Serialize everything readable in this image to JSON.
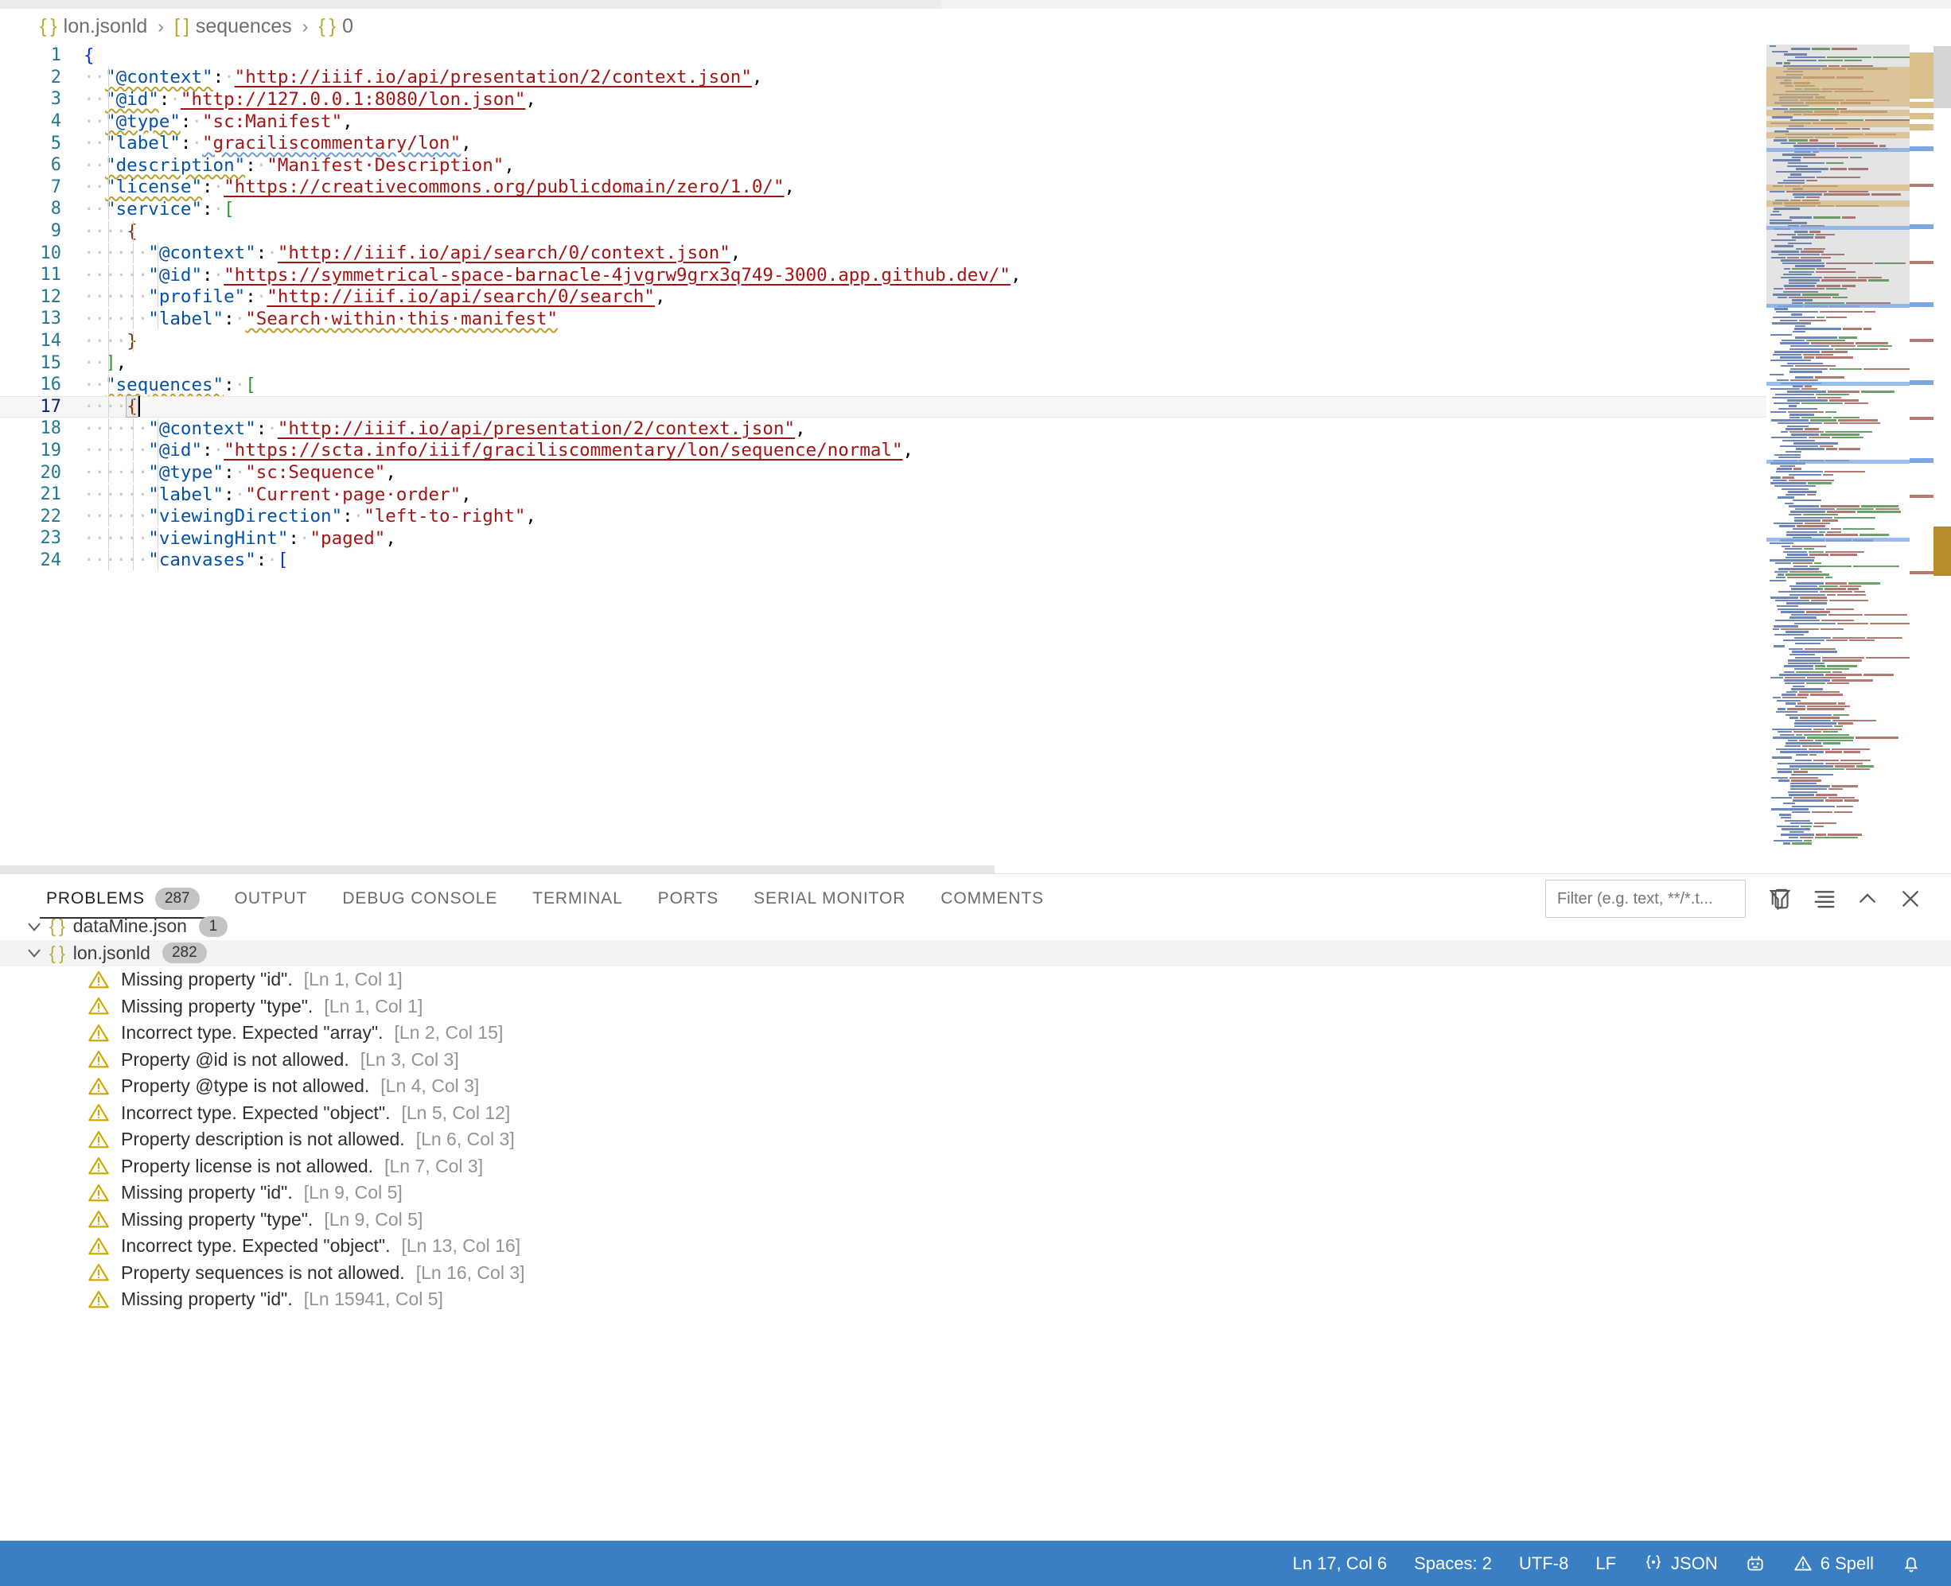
{
  "breadcrumb": {
    "items": [
      {
        "icon": "json-object-icon",
        "sym": "{ }",
        "label": "lon.jsonld"
      },
      {
        "icon": "json-array-icon",
        "sym": "[ ]",
        "label": "sequences"
      },
      {
        "icon": "json-object-icon",
        "sym": "{ }",
        "label": "0"
      }
    ],
    "separator": "›"
  },
  "editor": {
    "language": "JSON",
    "cursor_line": 17,
    "lines": [
      {
        "n": 1,
        "tokens": [
          {
            "t": "{",
            "c": "br"
          }
        ]
      },
      {
        "n": 2,
        "tokens": [
          {
            "t": "··",
            "c": "dot"
          },
          {
            "t": "\"@context\"",
            "c": "k sq"
          },
          {
            "t": ":",
            "c": "p"
          },
          {
            "t": "·",
            "c": "dot"
          },
          {
            "t": "\"http://iiif.io/api/presentation/2/context.json\"",
            "c": "s ul"
          },
          {
            "t": ",",
            "c": "p"
          }
        ]
      },
      {
        "n": 3,
        "tokens": [
          {
            "t": "··",
            "c": "dot"
          },
          {
            "t": "\"@id\"",
            "c": "k sq"
          },
          {
            "t": ":",
            "c": "p"
          },
          {
            "t": "·",
            "c": "dot"
          },
          {
            "t": "\"http://127.0.0.1:8080/lon.json\"",
            "c": "s ul"
          },
          {
            "t": ",",
            "c": "p"
          }
        ]
      },
      {
        "n": 4,
        "tokens": [
          {
            "t": "··",
            "c": "dot"
          },
          {
            "t": "\"@type\"",
            "c": "k sq"
          },
          {
            "t": ":",
            "c": "p"
          },
          {
            "t": "·",
            "c": "dot"
          },
          {
            "t": "\"sc:Manifest\"",
            "c": "s"
          },
          {
            "t": ",",
            "c": "p"
          }
        ]
      },
      {
        "n": 5,
        "tokens": [
          {
            "t": "··",
            "c": "dot"
          },
          {
            "t": "\"label\"",
            "c": "k"
          },
          {
            "t": ":",
            "c": "p"
          },
          {
            "t": "·",
            "c": "dot"
          },
          {
            "t": "\"graciliscommentary/lon\"",
            "c": "s sqb"
          },
          {
            "t": ",",
            "c": "p"
          }
        ]
      },
      {
        "n": 6,
        "tokens": [
          {
            "t": "··",
            "c": "dot"
          },
          {
            "t": "\"description\"",
            "c": "k sq"
          },
          {
            "t": ":",
            "c": "p"
          },
          {
            "t": "·",
            "c": "dot"
          },
          {
            "t": "\"Manifest·Description\"",
            "c": "s"
          },
          {
            "t": ",",
            "c": "p"
          }
        ]
      },
      {
        "n": 7,
        "tokens": [
          {
            "t": "··",
            "c": "dot"
          },
          {
            "t": "\"license\"",
            "c": "k sq"
          },
          {
            "t": ":",
            "c": "p"
          },
          {
            "t": "·",
            "c": "dot"
          },
          {
            "t": "\"https://creativecommons.org/publicdomain/zero/1.0/\"",
            "c": "s ul"
          },
          {
            "t": ",",
            "c": "p"
          }
        ]
      },
      {
        "n": 8,
        "tokens": [
          {
            "t": "··",
            "c": "dot"
          },
          {
            "t": "\"service\"",
            "c": "k"
          },
          {
            "t": ":",
            "c": "p"
          },
          {
            "t": "·",
            "c": "dot"
          },
          {
            "t": "[",
            "c": "br2"
          }
        ]
      },
      {
        "n": 9,
        "tokens": [
          {
            "t": "····",
            "c": "dot"
          },
          {
            "t": "{",
            "c": "br3"
          }
        ]
      },
      {
        "n": 10,
        "tokens": [
          {
            "t": "······",
            "c": "dot"
          },
          {
            "t": "\"@context\"",
            "c": "k"
          },
          {
            "t": ":",
            "c": "p"
          },
          {
            "t": "·",
            "c": "dot"
          },
          {
            "t": "\"http://iiif.io/api/search/0/context.json\"",
            "c": "s ul"
          },
          {
            "t": ",",
            "c": "p"
          }
        ]
      },
      {
        "n": 11,
        "tokens": [
          {
            "t": "······",
            "c": "dot"
          },
          {
            "t": "\"@id\"",
            "c": "k"
          },
          {
            "t": ":",
            "c": "p"
          },
          {
            "t": "·",
            "c": "dot"
          },
          {
            "t": "\"https://symmetrical-space-barnacle-4jvgrw9grx3q749-3000.app.github.dev/\"",
            "c": "s ul"
          },
          {
            "t": ",",
            "c": "p"
          }
        ]
      },
      {
        "n": 12,
        "tokens": [
          {
            "t": "······",
            "c": "dot"
          },
          {
            "t": "\"profile\"",
            "c": "k"
          },
          {
            "t": ":",
            "c": "p"
          },
          {
            "t": "·",
            "c": "dot"
          },
          {
            "t": "\"http://iiif.io/api/search/0/search\"",
            "c": "s ul"
          },
          {
            "t": ",",
            "c": "p"
          }
        ]
      },
      {
        "n": 13,
        "tokens": [
          {
            "t": "······",
            "c": "dot"
          },
          {
            "t": "\"label\"",
            "c": "k"
          },
          {
            "t": ":",
            "c": "p"
          },
          {
            "t": "·",
            "c": "dot"
          },
          {
            "t": "\"Search·within·this·manifest\"",
            "c": "s sq"
          }
        ]
      },
      {
        "n": 14,
        "tokens": [
          {
            "t": "····",
            "c": "dot"
          },
          {
            "t": "}",
            "c": "br3"
          }
        ]
      },
      {
        "n": 15,
        "tokens": [
          {
            "t": "··",
            "c": "dot"
          },
          {
            "t": "]",
            "c": "br2"
          },
          {
            "t": ",",
            "c": "p"
          }
        ]
      },
      {
        "n": 16,
        "tokens": [
          {
            "t": "··",
            "c": "dot"
          },
          {
            "t": "\"sequences\"",
            "c": "k sq"
          },
          {
            "t": ":",
            "c": "p"
          },
          {
            "t": "·",
            "c": "dot"
          },
          {
            "t": "[",
            "c": "br2"
          }
        ]
      },
      {
        "n": 17,
        "tokens": [
          {
            "t": "····",
            "c": "dot"
          },
          {
            "t": "{",
            "c": "br3 bracketbox"
          }
        ],
        "current": true,
        "cursor": true
      },
      {
        "n": 18,
        "tokens": [
          {
            "t": "······",
            "c": "dot"
          },
          {
            "t": "\"@context\"",
            "c": "k"
          },
          {
            "t": ":",
            "c": "p"
          },
          {
            "t": "·",
            "c": "dot"
          },
          {
            "t": "\"http://iiif.io/api/presentation/2/context.json\"",
            "c": "s ul"
          },
          {
            "t": ",",
            "c": "p"
          }
        ]
      },
      {
        "n": 19,
        "tokens": [
          {
            "t": "······",
            "c": "dot"
          },
          {
            "t": "\"@id\"",
            "c": "k"
          },
          {
            "t": ":",
            "c": "p"
          },
          {
            "t": "·",
            "c": "dot"
          },
          {
            "t": "\"https://scta.info/iiif/graciliscommentary/lon/sequence/normal\"",
            "c": "s ul"
          },
          {
            "t": ",",
            "c": "p"
          }
        ]
      },
      {
        "n": 20,
        "tokens": [
          {
            "t": "······",
            "c": "dot"
          },
          {
            "t": "\"@type\"",
            "c": "k"
          },
          {
            "t": ":",
            "c": "p"
          },
          {
            "t": "·",
            "c": "dot"
          },
          {
            "t": "\"sc:Sequence\"",
            "c": "s"
          },
          {
            "t": ",",
            "c": "p"
          }
        ]
      },
      {
        "n": 21,
        "tokens": [
          {
            "t": "······",
            "c": "dot"
          },
          {
            "t": "\"label\"",
            "c": "k"
          },
          {
            "t": ":",
            "c": "p"
          },
          {
            "t": "·",
            "c": "dot"
          },
          {
            "t": "\"Current·page·order\"",
            "c": "s"
          },
          {
            "t": ",",
            "c": "p"
          }
        ]
      },
      {
        "n": 22,
        "tokens": [
          {
            "t": "······",
            "c": "dot"
          },
          {
            "t": "\"viewingDirection\"",
            "c": "k"
          },
          {
            "t": ":",
            "c": "p"
          },
          {
            "t": "·",
            "c": "dot"
          },
          {
            "t": "\"left-to-right\"",
            "c": "s"
          },
          {
            "t": ",",
            "c": "p"
          }
        ]
      },
      {
        "n": 23,
        "tokens": [
          {
            "t": "······",
            "c": "dot"
          },
          {
            "t": "\"viewingHint\"",
            "c": "k"
          },
          {
            "t": ":",
            "c": "p"
          },
          {
            "t": "·",
            "c": "dot"
          },
          {
            "t": "\"paged\"",
            "c": "s"
          },
          {
            "t": ",",
            "c": "p"
          }
        ]
      },
      {
        "n": 24,
        "tokens": [
          {
            "t": "······",
            "c": "dot"
          },
          {
            "t": "\"canvases\"",
            "c": "k"
          },
          {
            "t": ":",
            "c": "p"
          },
          {
            "t": "·",
            "c": "dot"
          },
          {
            "t": "[",
            "c": "br"
          }
        ]
      }
    ]
  },
  "panel": {
    "tabs": [
      {
        "label": "PROBLEMS",
        "badge": "287",
        "active": true
      },
      {
        "label": "OUTPUT",
        "badge": null,
        "active": false
      },
      {
        "label": "DEBUG CONSOLE",
        "badge": null,
        "active": false
      },
      {
        "label": "TERMINAL",
        "badge": null,
        "active": false
      },
      {
        "label": "PORTS",
        "badge": null,
        "active": false
      },
      {
        "label": "SERIAL MONITOR",
        "badge": null,
        "active": false
      },
      {
        "label": "COMMENTS",
        "badge": null,
        "active": false
      }
    ],
    "filter": {
      "value": "",
      "placeholder": "Filter (e.g. text, **/*.t..."
    },
    "actions": [
      {
        "name": "filter-icon",
        "title": "Filter"
      },
      {
        "name": "split-panel-icon",
        "title": "Views and More Actions"
      },
      {
        "name": "collapse-all-icon",
        "title": "Collapse All"
      },
      {
        "name": "chevron-up-icon",
        "title": "Maximize Panel Size"
      },
      {
        "name": "close-icon",
        "title": "Close Panel"
      }
    ],
    "groups": [
      {
        "sym": "{ }",
        "file": "dataMine.json",
        "count": "1",
        "expanded": true,
        "problems": []
      },
      {
        "sym": "{ }",
        "file": "lon.jsonld",
        "count": "282",
        "expanded": true,
        "problems": [
          {
            "severity": "warning",
            "message": "Missing property \"id\".",
            "location": "[Ln 1, Col 1]"
          },
          {
            "severity": "warning",
            "message": "Missing property \"type\".",
            "location": "[Ln 1, Col 1]"
          },
          {
            "severity": "warning",
            "message": "Incorrect type. Expected \"array\".",
            "location": "[Ln 2, Col 15]"
          },
          {
            "severity": "warning",
            "message": "Property @id is not allowed.",
            "location": "[Ln 3, Col 3]"
          },
          {
            "severity": "warning",
            "message": "Property @type is not allowed.",
            "location": "[Ln 4, Col 3]"
          },
          {
            "severity": "warning",
            "message": "Incorrect type. Expected \"object\".",
            "location": "[Ln 5, Col 12]"
          },
          {
            "severity": "warning",
            "message": "Property description is not allowed.",
            "location": "[Ln 6, Col 3]"
          },
          {
            "severity": "warning",
            "message": "Property license is not allowed.",
            "location": "[Ln 7, Col 3]"
          },
          {
            "severity": "warning",
            "message": "Missing property \"id\".",
            "location": "[Ln 9, Col 5]"
          },
          {
            "severity": "warning",
            "message": "Missing property \"type\".",
            "location": "[Ln 9, Col 5]"
          },
          {
            "severity": "warning",
            "message": "Incorrect type. Expected \"object\".",
            "location": "[Ln 13, Col 16]"
          },
          {
            "severity": "warning",
            "message": "Property sequences is not allowed.",
            "location": "[Ln 16, Col 3]"
          },
          {
            "severity": "warning",
            "message": "Missing property \"id\".",
            "location": "[Ln 15941, Col 5]"
          }
        ]
      }
    ]
  },
  "status_bar": {
    "background": "#3a7ec4",
    "items": [
      {
        "name": "editor-position",
        "label": "Ln 17, Col 6",
        "icon": null
      },
      {
        "name": "indentation",
        "label": "Spaces: 2",
        "icon": null
      },
      {
        "name": "encoding",
        "label": "UTF-8",
        "icon": null
      },
      {
        "name": "eol",
        "label": "LF",
        "icon": null
      },
      {
        "name": "language-mode",
        "label": "JSON",
        "icon": "json-braces-icon"
      },
      {
        "name": "hubot-icon",
        "label": "",
        "icon": "hubot-icon"
      },
      {
        "name": "spell-checker",
        "label": "6 Spell",
        "icon": "warning-icon"
      },
      {
        "name": "notifications",
        "label": "",
        "icon": "bell-icon"
      }
    ]
  },
  "colors": {
    "accent_blue": "#3a7ec4",
    "json_key": "#0451a5",
    "json_string": "#a31515",
    "warning": "#cca700",
    "line_number": "#237893",
    "breadcrumb_symbol": "#b5ab37"
  }
}
